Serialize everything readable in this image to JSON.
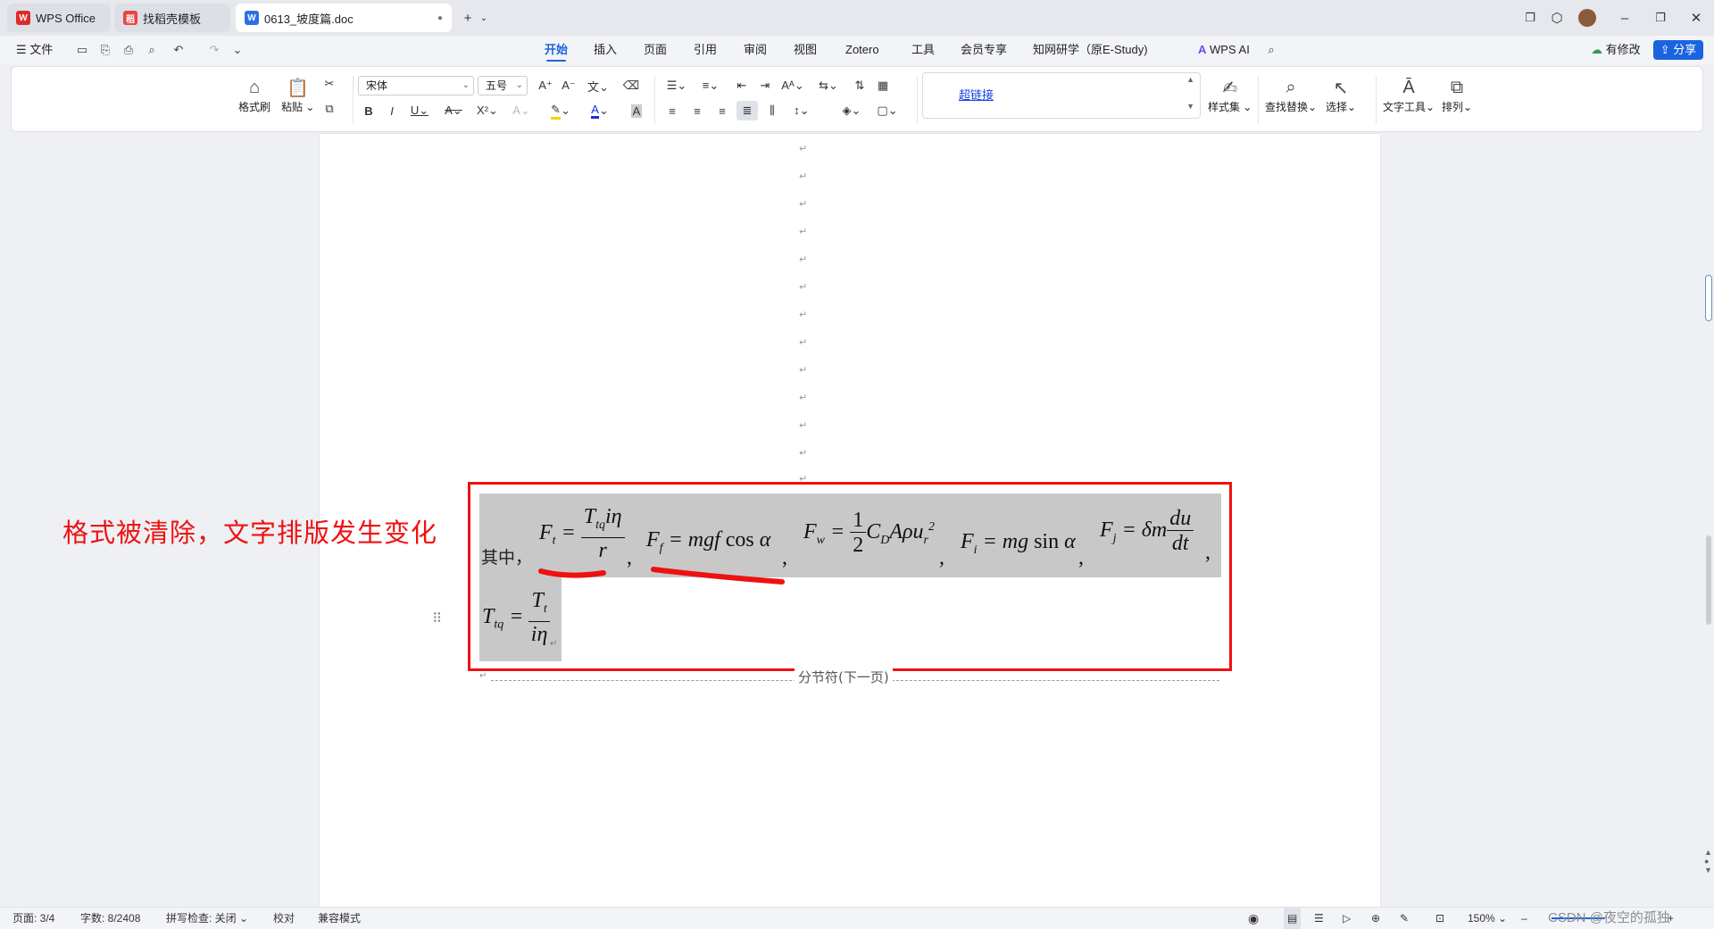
{
  "tabs": [
    {
      "label": "WPS Office",
      "icon": "wps-logo-icon"
    },
    {
      "label": "找稻壳模板",
      "icon": "docer-icon"
    },
    {
      "label": "0613_坡度篇.doc",
      "icon": "word-doc-icon"
    }
  ],
  "menu": {
    "file_label": "文件",
    "items": [
      "开始",
      "插入",
      "页面",
      "引用",
      "审阅",
      "视图",
      "Zotero",
      "工具",
      "会员专享",
      "知网研学（原E-Study)"
    ],
    "active": "开始",
    "wps_ai": "WPS AI",
    "modified": "有修改",
    "share": "分享"
  },
  "ribbon": {
    "format_painter": "格式刷",
    "paste": "粘贴",
    "font_name": "宋体",
    "font_size": "五号",
    "hyperlink_style": "超链接",
    "style_set": "样式集",
    "find_replace": "查找替换",
    "select": "选择",
    "text_tools": "文字工具",
    "arrange": "排列"
  },
  "document": {
    "prefix": "其中，",
    "section_break": "分节符(下一页)"
  },
  "annotation": "格式被清除，文字排版发生变化",
  "status": {
    "page": "页面: 3/4",
    "word_count": "字数: 8/2408",
    "spell_check": "拼写检查: 关闭",
    "proofread": "校对",
    "compat_mode": "兼容模式",
    "zoom": "150%",
    "watermark": "CSDN @夜空的孤独"
  },
  "colors": {
    "accent": "#1a64e0",
    "annotation_red": "#ee1111",
    "selection_gray": "#c8c8c8"
  }
}
